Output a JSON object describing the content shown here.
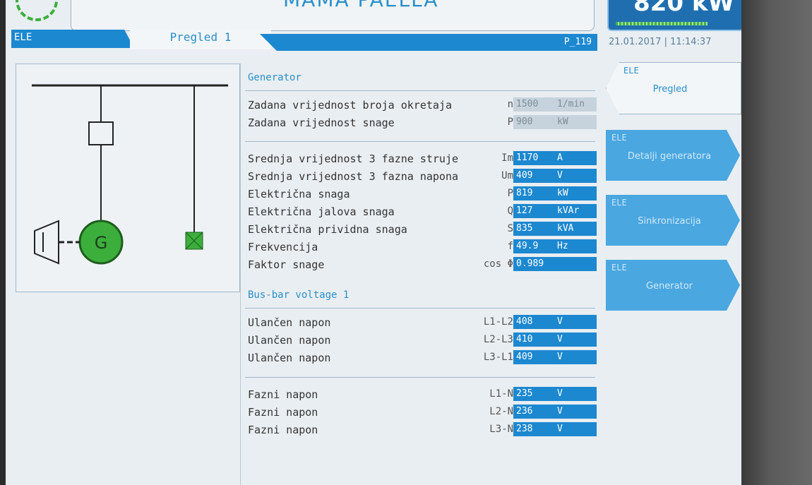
{
  "header": {
    "title": "MAMA PAELLA",
    "power_value": "820 kW",
    "datetime": "21.01.2017 | 11:14:37"
  },
  "tabs": {
    "group": "ELE",
    "active": "Pregled 1",
    "page_code": "P_119"
  },
  "generator": {
    "section_title": "Generator",
    "setpoints": [
      {
        "label": "Zadana vrijednost broja okretaja",
        "symbol": "n",
        "value": "1500",
        "unit": "1/min"
      },
      {
        "label": "Zadana vrijednost snage",
        "symbol": "P",
        "value": "900",
        "unit": "kW"
      }
    ],
    "measurements": [
      {
        "label": "Srednja vrijednost 3 fazne struje",
        "symbol": "Im",
        "value": "1170",
        "unit": "A"
      },
      {
        "label": "Srednja vrijednost 3 fazna napona",
        "symbol": "Um",
        "value": "409",
        "unit": "V"
      },
      {
        "label": "Električna snaga",
        "symbol": "P",
        "value": "819",
        "unit": "kW"
      },
      {
        "label": "Električna jalova snaga",
        "symbol": "Q",
        "value": "127",
        "unit": "kVAr"
      },
      {
        "label": "Električna prividna snaga",
        "symbol": "S",
        "value": "835",
        "unit": "kVA"
      },
      {
        "label": "Frekvencija",
        "symbol": "f",
        "value": "49.9",
        "unit": "Hz"
      },
      {
        "label": "Faktor snage",
        "symbol": "cos Φ",
        "value": "0.989",
        "unit": ""
      }
    ]
  },
  "busbar": {
    "section_title": "Bus-bar voltage 1",
    "line_voltages": [
      {
        "label": "Ulančen napon",
        "symbol": "L1-L2",
        "value": "408",
        "unit": "V"
      },
      {
        "label": "Ulančen napon",
        "symbol": "L2-L3",
        "value": "410",
        "unit": "V"
      },
      {
        "label": "Ulančen napon",
        "symbol": "L3-L1",
        "value": "409",
        "unit": "V"
      }
    ],
    "phase_voltages": [
      {
        "label": "Fazni napon",
        "symbol": "L1-N",
        "value": "235",
        "unit": "V"
      },
      {
        "label": "Fazni napon",
        "symbol": "L2-N",
        "value": "236",
        "unit": "V"
      },
      {
        "label": "Fazni napon",
        "symbol": "L3-N",
        "value": "238",
        "unit": "V"
      }
    ]
  },
  "diagram": {
    "generator_symbol": "G"
  },
  "nav": [
    {
      "tag": "ELE",
      "label": "Pregled",
      "active": true
    },
    {
      "tag": "ELE",
      "label": "Detalji generatora",
      "active": false
    },
    {
      "tag": "ELE",
      "label": "Sinkronizacija",
      "active": false
    },
    {
      "tag": "ELE",
      "label": "Generator",
      "active": false
    }
  ],
  "colors": {
    "accent": "#1c88d0",
    "generator_green": "#3cae3c",
    "nav_inactive": "#4aa7e0"
  }
}
